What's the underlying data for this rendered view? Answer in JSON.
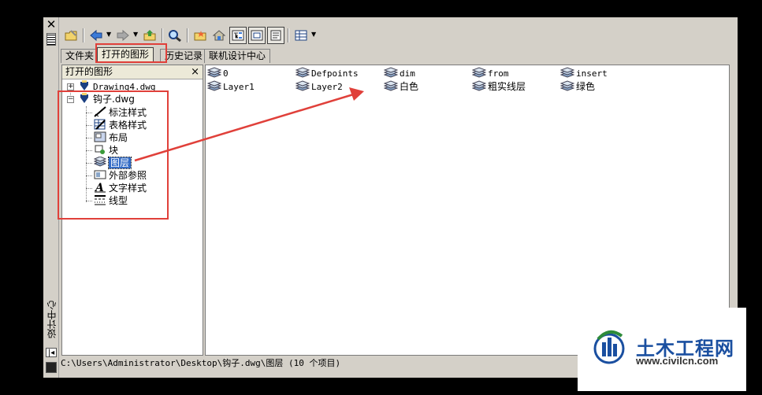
{
  "window": {
    "vertical_title": "设计中心"
  },
  "tabs": [
    {
      "label": "文件夹"
    },
    {
      "label": "打开的图形"
    },
    {
      "label": "历史记录"
    },
    {
      "label": "联机设计中心"
    }
  ],
  "left_panel": {
    "title": "打开的图形",
    "close_glyph": "×",
    "tree": [
      {
        "label": "Drawing4.dwg",
        "expander": "+"
      },
      {
        "label": "钩子.dwg",
        "expander": "−"
      },
      {
        "label": "标注样式",
        "icon": "dimstyle-icon"
      },
      {
        "label": "表格样式",
        "icon": "tablestyle-icon"
      },
      {
        "label": "布局",
        "icon": "layout-icon"
      },
      {
        "label": "块",
        "icon": "block-icon"
      },
      {
        "label": "图层",
        "icon": "layer-icon",
        "selected": true
      },
      {
        "label": "外部参照",
        "icon": "xref-icon"
      },
      {
        "label": "文字样式",
        "icon": "textstyle-icon"
      },
      {
        "label": "线型",
        "icon": "linetype-icon"
      }
    ]
  },
  "right_panel": {
    "items": [
      {
        "label": "0"
      },
      {
        "label": "Defpoints"
      },
      {
        "label": "dim"
      },
      {
        "label": "from"
      },
      {
        "label": "insert"
      },
      {
        "label": "Layer1"
      },
      {
        "label": "Layer2"
      },
      {
        "label": "白色"
      },
      {
        "label": "粗实线层"
      },
      {
        "label": "绿色"
      }
    ]
  },
  "status_bar": {
    "text": "C:\\Users\\Administrator\\Desktop\\钩子.dwg\\图层 (10 个项目)"
  },
  "annotation": {
    "color": "#e0403a"
  },
  "watermark": {
    "brand": "土木工程网",
    "url": "www.civilcn.com"
  }
}
